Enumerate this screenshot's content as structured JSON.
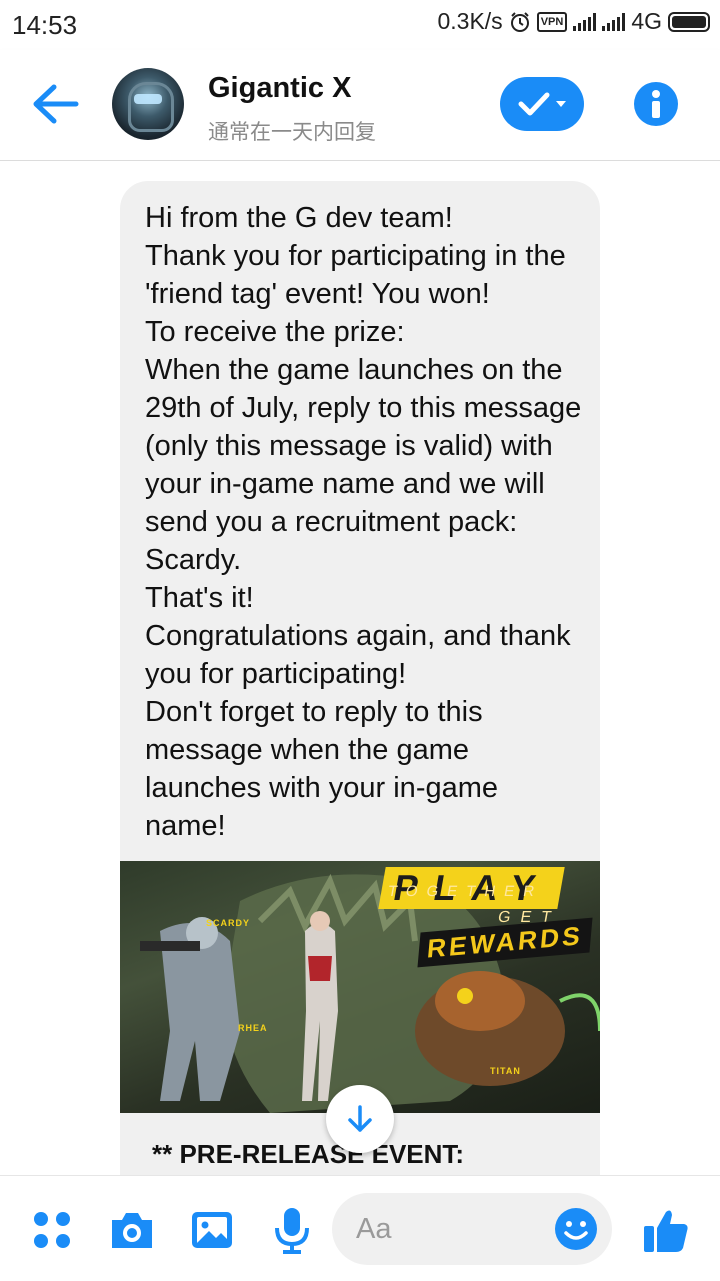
{
  "status_bar": {
    "time": "14:53",
    "speed": "0.3K/s",
    "vpn": "VPN",
    "network": "4G",
    "icons": [
      "alarm-icon",
      "vpn-icon",
      "signal-icon",
      "signal-icon",
      "battery-icon"
    ]
  },
  "header": {
    "contact_name": "Gigantic X",
    "contact_status": "通常在一天内回复",
    "icons": [
      "back-arrow-icon",
      "checkmark-icon",
      "info-icon"
    ]
  },
  "message": {
    "text": "Hi from the G dev team!\nThank you for participating in the 'friend tag' event! You won!\nTo receive the prize:\nWhen the game launches on the 29th of July, reply to this message (only this message is valid) with your in-game name and we will send you a recruitment pack: Scardy.\nThat's it!\nCongratulations again, and thank you for participating!\nDon't forget to reply to this message when the game launches with your in-game name!",
    "image": {
      "play": "PLAY",
      "together": "TOGETHER",
      "get": "GET",
      "rewards": "REWARDS",
      "tag_scardy": "SCARDY",
      "tag_rhea": "RHEA",
      "tag_titan": "TITAN"
    },
    "event_heading": "** PRE-RELEASE EVENT:"
  },
  "composer": {
    "placeholder": "Aa",
    "icons": [
      "more-icon",
      "camera-icon",
      "gallery-icon",
      "microphone-icon",
      "emoji-icon",
      "thumbs-up-icon"
    ]
  },
  "colors": {
    "accent": "#1a8cf7",
    "bubble": "#f0f0f0"
  }
}
